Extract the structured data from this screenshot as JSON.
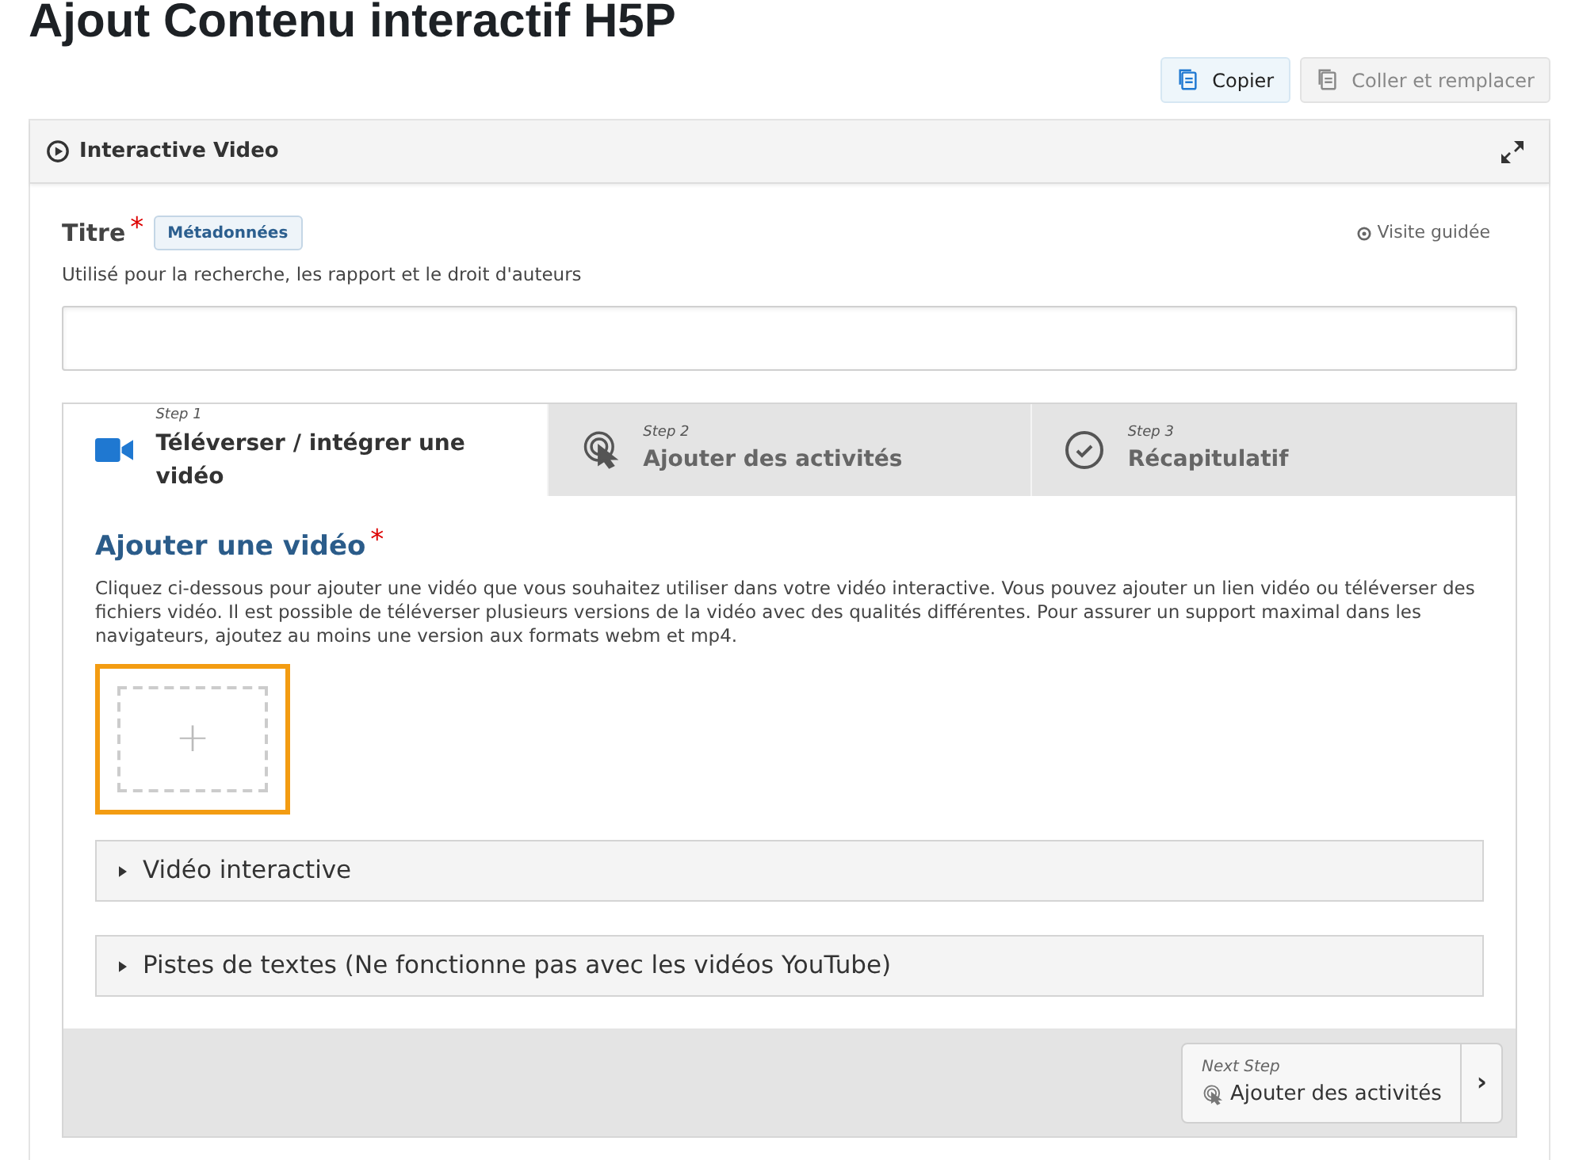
{
  "page_title": "Ajout Contenu interactif H5P",
  "toolbar": [
    {
      "label": "Copier",
      "disabled": false
    },
    {
      "label": "Coller et remplacer",
      "disabled": true
    }
  ],
  "panel": {
    "title": "Interactive Video"
  },
  "title_field": {
    "label": "Titre",
    "required_mark": "*",
    "badge": "Métadonnées",
    "tour_link": "Visite guidée",
    "description": "Utilisé pour la recherche, les rapport et le droit d'auteurs"
  },
  "steps": [
    {
      "kind": "camera",
      "step": "Step 1",
      "label": "Téléverser / intégrer une vidéo",
      "selected": true
    },
    {
      "kind": "touch",
      "step": "Step 2",
      "label": "Ajouter des activités",
      "selected": false
    },
    {
      "kind": "check",
      "step": "Step 3",
      "label": "Récapitulatif",
      "selected": false
    }
  ],
  "video_section": {
    "heading": "Ajouter une vidéo",
    "required_mark": "*",
    "description": "Cliquez ci-dessous pour ajouter une vidéo que vous souhaitez utiliser dans votre vidéo interactive. Vous pouvez ajouter un lien vidéo ou téléverser des fichiers vidéo. Il est possible de téléverser plusieurs versions de la vidéo avec des qualités différentes. Pour assurer un support maximal dans les navigateurs, ajoutez au moins une version aux formats webm et mp4.",
    "add_symbol": "+"
  },
  "collapsibles": [
    {
      "label": "Vidéo interactive",
      "expanded": false
    },
    {
      "label": "Pistes de textes (Ne fonctionne pas avec les vidéos YouTube)",
      "expanded": false
    }
  ],
  "next_step": {
    "caption": "Next Step",
    "label": "Ajouter des activités",
    "arrow": "›"
  }
}
